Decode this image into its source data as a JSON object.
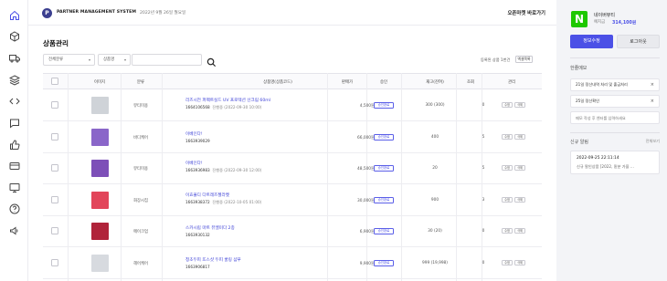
{
  "header": {
    "logo_letter": "P",
    "brand": "PARTNER MANAGEMENT SYSTEM",
    "date": "2022년 9월 26일 월요일",
    "open_market": "오픈마켓 바로가기"
  },
  "rail_icons": [
    "home-icon",
    "box-icon",
    "truck-icon",
    "layers-icon",
    "code-icon",
    "chat-icon",
    "thumbs-up-icon",
    "card-icon",
    "monitor-icon",
    "help-icon",
    "megaphone-icon"
  ],
  "page": {
    "title": "상품관리",
    "filter_category": "전체분류",
    "filter_field": "상품명",
    "search_placeholder": "",
    "sort_label": "등록된 상품 1번건",
    "sort_button": "엑셀목록"
  },
  "table": {
    "headers": [
      "이미지",
      "분류",
      "상품명(상품코드)",
      "판매가",
      "승인",
      "재고(잔여)",
      "조회",
      "관리"
    ],
    "rows": [
      {
        "category": "뷰티미용",
        "name": "리즈시전 퍼펙트실드 UV 프로텍션 선크림 60ml",
        "code": "1664106568",
        "info": "진행중 (2022-09-30 10:00)",
        "price": "4,500원",
        "status": "승인완료",
        "stock": "300 (300)",
        "views": "0",
        "thumb_color": "#cfd3d8"
      },
      {
        "category": "바디케어",
        "name": "이베인다!",
        "code": "1663939029",
        "info": "",
        "price": "66,000원",
        "status": "승인완료",
        "stock": "400",
        "views": "5",
        "thumb_color": "#8a66c9"
      },
      {
        "category": "뷰티미용",
        "name": "이베인다!",
        "code": "1663936983",
        "info": "진행중 (2022-09-30 12:00)",
        "price": "48,500원",
        "status": "승인완료",
        "stock": "20",
        "views": "5",
        "thumb_color": "#7d4fb8"
      },
      {
        "category": "화장시집",
        "name": "이효율디 다트레즈젤라켓",
        "code": "1663938372",
        "info": "진행중 (2022-10-05 01:00)",
        "price": "30,000원",
        "status": "승인완료",
        "stock": "900",
        "views": "3",
        "thumb_color": "#e2455a"
      },
      {
        "category": "메이크업",
        "name": "스카시립 마트 뷰엘미다 2종",
        "code": "1663930132",
        "info": "",
        "price": "6,900원",
        "status": "승인완료",
        "stock": "30 (20)",
        "views": "0",
        "thumb_color": "#b0233a"
      },
      {
        "category": "헤어케어",
        "name": "청초두피 뜨스샷 두피 쿨링 샴푸",
        "code": "1663906817",
        "info": "",
        "price": "9,900원",
        "status": "승인완료",
        "stock": "999 (19,998)",
        "views": "0",
        "thumb_color": "#d7dadf"
      }
    ],
    "edit_label": "수정",
    "delete_label": "삭제"
  },
  "sidebar": {
    "store_logo": "N",
    "store_name": "네이버뷰티",
    "deposit_label": "예치금",
    "deposit_amount": "314,100원",
    "info_button": "정보수정",
    "logout_button": "로그아웃",
    "memo_title": "한줄메모",
    "memos": [
      "21일 정산내역 처리 및 출금처리",
      "25일 정산확인"
    ],
    "memo_placeholder": "메모 작성 후 엔터를 입력하세요",
    "alarm_title": "신규 알림",
    "alarm_see_all": "전체보기",
    "notice_time": "2022-09-25 22:11:14",
    "notice_text": "신규 팔인상품 [2022, 밑분 가을 …"
  },
  "colors": {
    "accent": "#4b50e6",
    "naver_green": "#1ec800",
    "link": "#3b3fd6"
  }
}
